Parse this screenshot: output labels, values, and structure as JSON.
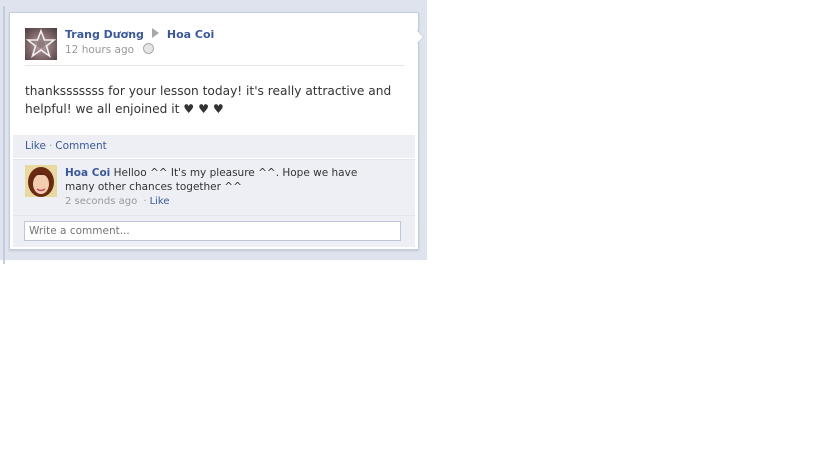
{
  "post": {
    "author": "Trang Dương",
    "target": "Hoa Coi",
    "timestamp": "12 hours ago",
    "text": "thanksssssss for your lesson today! it's really attractive and helpful! we all enjoined it ♥ ♥ ♥"
  },
  "actions": {
    "like": "Like",
    "separator": "·",
    "comment": "Comment"
  },
  "comment": {
    "author": "Hoa Coi",
    "text": "Helloo ^^ It's my pleasure ^^. Hope we have many other chances together ^^",
    "timestamp": "2 seconds ago",
    "separator": "·",
    "like": "Like"
  },
  "write_comment": {
    "placeholder": "Write a comment..."
  },
  "icons": {
    "privacy": "globe-icon",
    "arrow": "triangle-right-icon"
  },
  "colors": {
    "link": "#3b5998",
    "muted": "#999999",
    "panel": "#edeff4"
  }
}
